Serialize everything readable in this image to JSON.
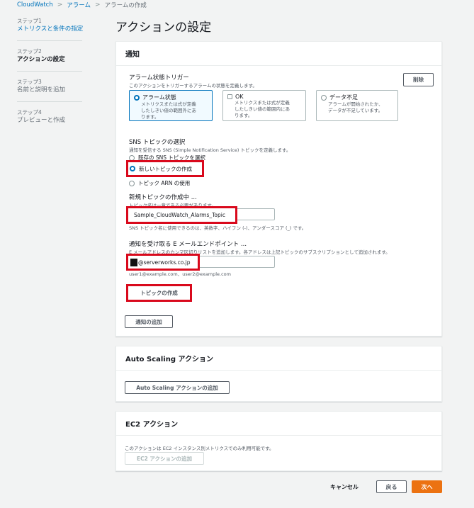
{
  "breadcrumb": [
    "CloudWatch",
    "アラーム",
    "アラームの作成"
  ],
  "nav": [
    {
      "step": "ステップ1",
      "title": "メトリクスと条件の指定",
      "state": "link"
    },
    {
      "step": "ステップ2",
      "title": "アクションの設定",
      "state": "current"
    },
    {
      "step": "ステップ3",
      "title": "名前と説明を追加",
      "state": "disabled"
    },
    {
      "step": "ステップ4",
      "title": "プレビューと作成",
      "state": "disabled"
    }
  ],
  "page_title": "アクションの設定",
  "notification": {
    "header": "通知",
    "trigger_label": "アラーム状態トリガー",
    "trigger_desc": "このアクションをトリガーするアラームの状態を定義します。",
    "remove_button": "削除",
    "tiles": [
      {
        "title": "アラーム状態",
        "desc1": "メトリクスまたは式が定義",
        "desc2": "したしきい値の範囲外にあ",
        "desc3": "ります。",
        "selected": true
      },
      {
        "title": "OK",
        "desc1": "メトリクスまたは式が定義",
        "desc2": "したしきい値の範囲内にあ",
        "desc3": "ります。",
        "selected": false
      },
      {
        "title": "データ不足",
        "desc1": "アラームが開始されたか、",
        "desc2": "データが不足しています。",
        "desc3": "",
        "selected": false
      }
    ],
    "sns_label": "SNS トピックの選択",
    "sns_desc": "通知を受信する SNS (Simple Notification Service) トピックを定義します。",
    "sns_options": [
      "既存の SNS トピックを選択",
      "新しいトピックの作成",
      "トピック ARN の使用"
    ],
    "new_topic_label": "新規トピックの作成中 ...",
    "new_topic_desc": "トピック名は一意である必要があります。",
    "topic_name_value": "Sample_CloudWatch_Alarms_Topic",
    "topic_name_hint": "SNS トピック名に使用できるのは、英数字、ハイフン (-)、アンダースコア (_) です。",
    "email_label": "通知を受け取る E メールエンドポイント ...",
    "email_desc": "E メールアドレスのカンマ区切りリストを追加します。各アドレスは上記トピックのサブスクリプションとして追加されます。",
    "email_value": "@serverworks.co.jp",
    "email_hint": "user1@example.com、user2@example.com",
    "create_topic_button": "トピックの作成",
    "add_notification_button": "通知の追加"
  },
  "autoscaling": {
    "header": "Auto Scaling アクション",
    "add_button": "Auto Scaling アクションの追加"
  },
  "ec2": {
    "header": "EC2 アクション",
    "desc": "このアクションは EC2 インスタンス別メトリクスでのみ利用可能です。",
    "add_button": "EC2 アクションの追加"
  },
  "footer": {
    "cancel": "キャンセル",
    "back": "戻る",
    "next": "次へ"
  },
  "colors": {
    "accent": "#0073bb",
    "primary": "#ec7211",
    "highlight": "#d9091c"
  }
}
